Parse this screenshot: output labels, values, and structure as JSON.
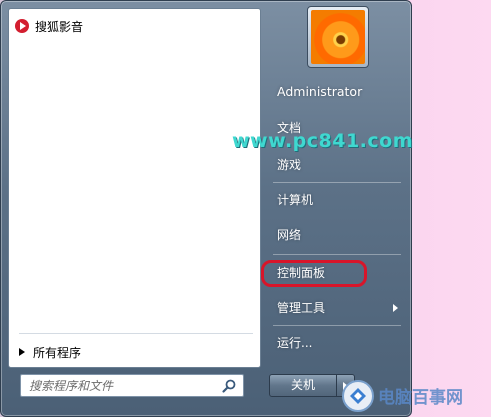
{
  "left_pane": {
    "pinned_programs": [
      {
        "label": "搜狐影音",
        "icon": "sohu-video-icon"
      }
    ],
    "all_programs_label": "所有程序",
    "search": {
      "placeholder": "搜索程序和文件",
      "value": ""
    }
  },
  "right_pane": {
    "user_name": "Administrator",
    "items": [
      {
        "label": "文档"
      },
      {
        "label": "游戏"
      },
      {
        "label": "计算机"
      },
      {
        "label": "网络"
      },
      {
        "label": "控制面板"
      },
      {
        "label": "管理工具"
      },
      {
        "label": "运行..."
      }
    ],
    "shutdown_label": "关机"
  },
  "watermark": "www.pc841.com",
  "corner_logo_text": "电脑百事网",
  "colors": {
    "menu_frame": "#5c7187",
    "highlight_ring": "#d8152a",
    "watermark": "#3fd8d0"
  }
}
